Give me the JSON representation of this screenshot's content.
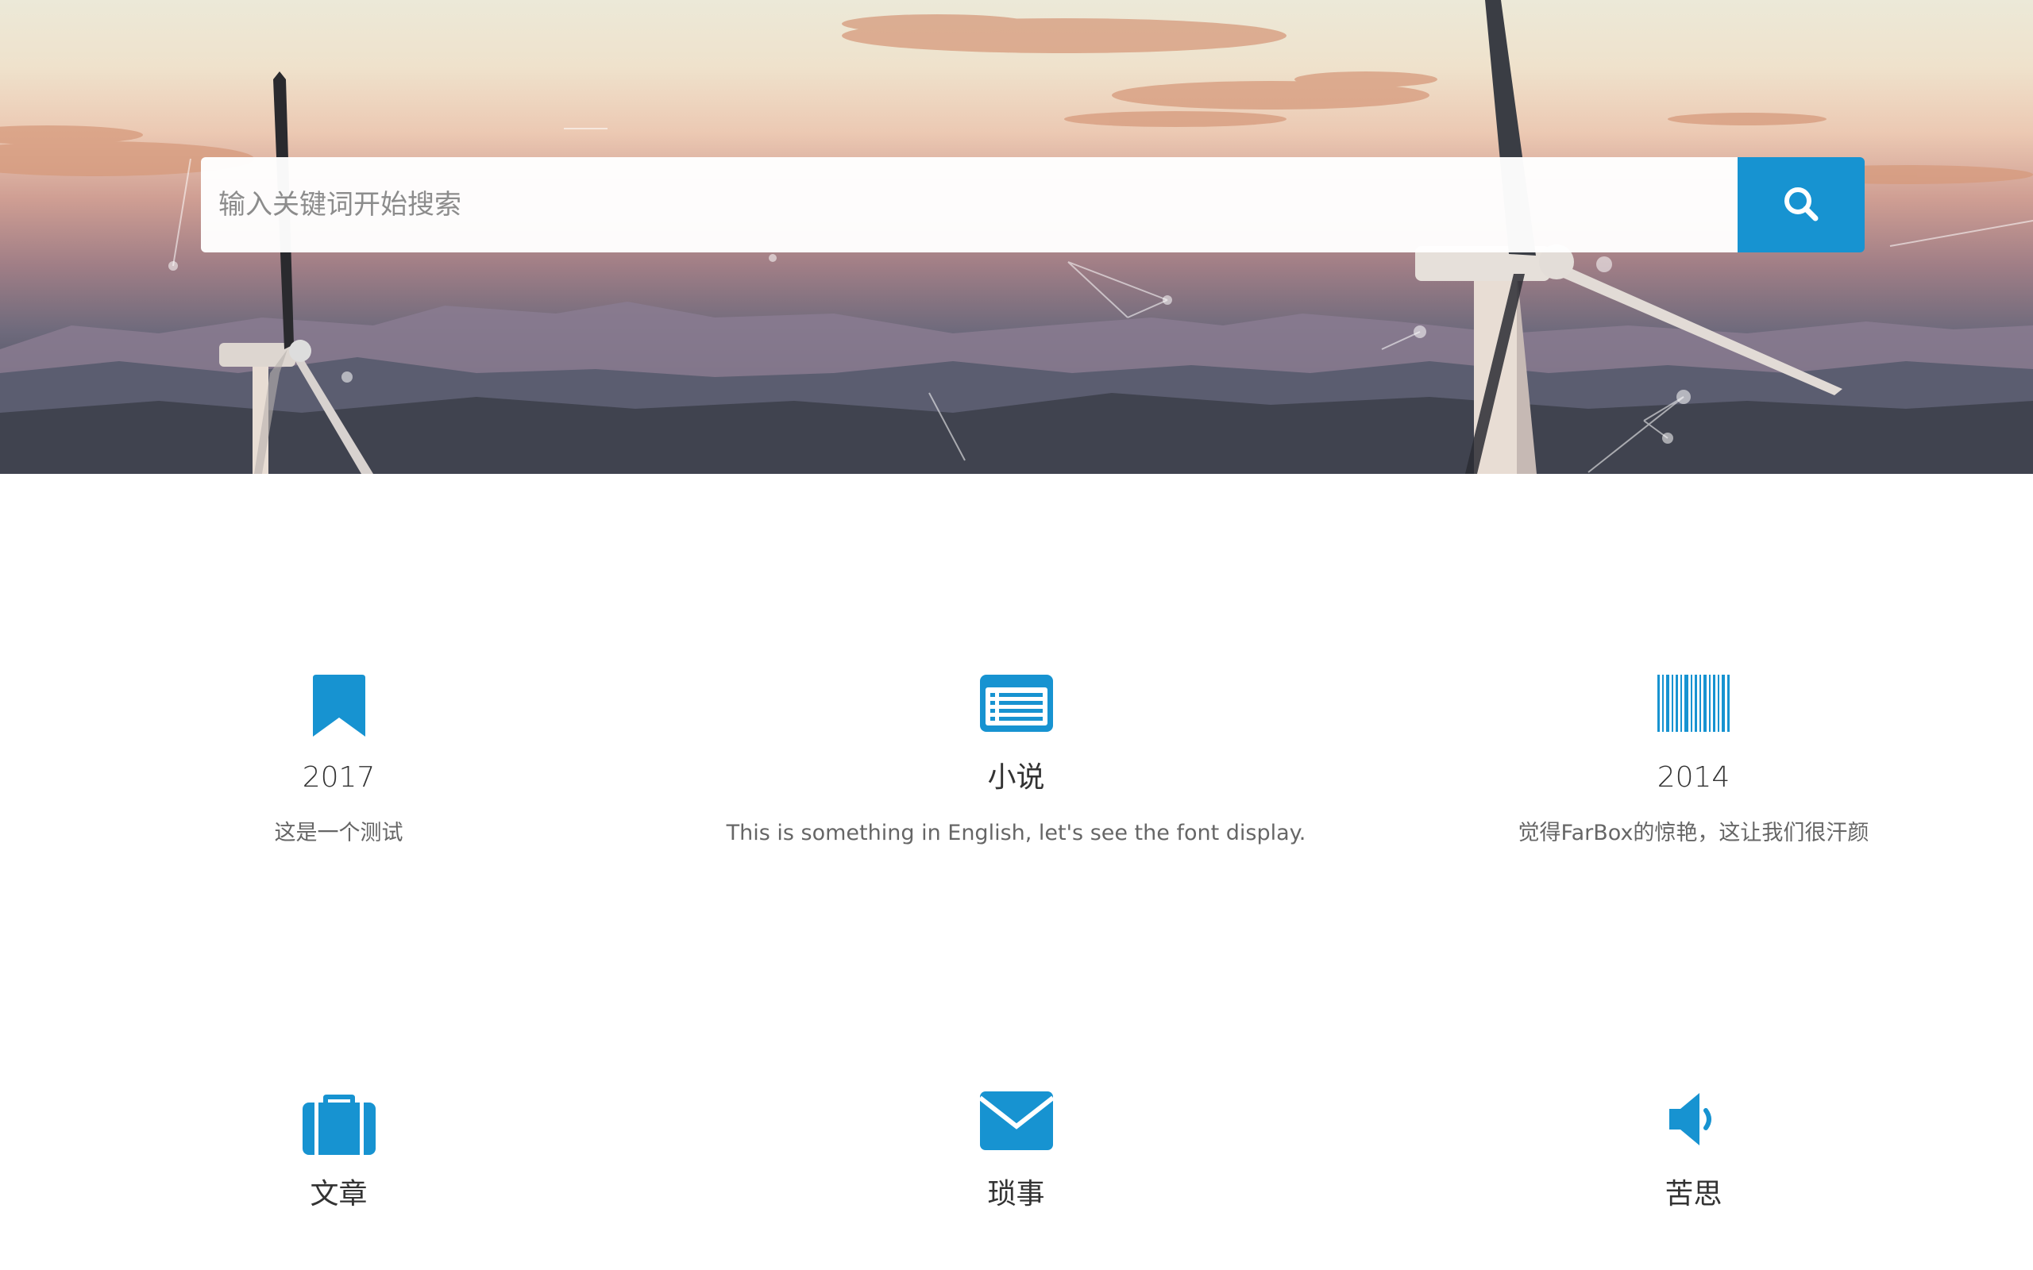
{
  "search": {
    "placeholder": "输入关键词开始搜索"
  },
  "colors": {
    "accent": "#1793d1"
  },
  "features": [
    {
      "icon": "bookmark-icon",
      "title": "2017",
      "desc": "这是一个测试"
    },
    {
      "icon": "list-icon",
      "title": "小说",
      "desc": "This is something in English, let's see the font display."
    },
    {
      "icon": "barcode-icon",
      "title": "2014",
      "desc": "觉得FarBox的惊艳，这让我们很汗颜"
    },
    {
      "icon": "briefcase-icon",
      "title": "文章",
      "desc": ""
    },
    {
      "icon": "envelope-icon",
      "title": "琐事",
      "desc": ""
    },
    {
      "icon": "volume-icon",
      "title": "苦思",
      "desc": ""
    }
  ]
}
